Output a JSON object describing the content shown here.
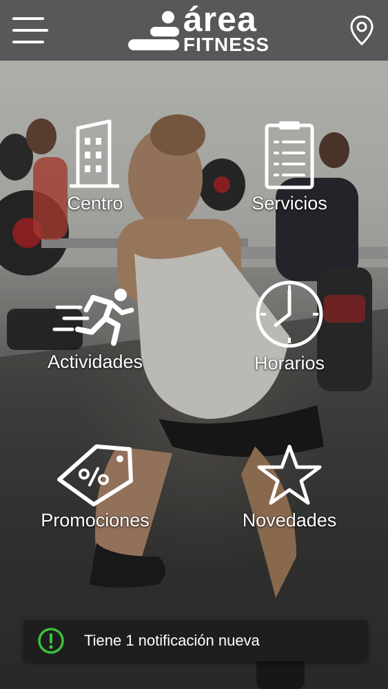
{
  "header": {
    "logo": {
      "word1": "área",
      "word2": "FITNESS"
    },
    "menu_icon": "hamburger-menu-icon",
    "location_icon": "map-pin-icon",
    "colors": {
      "bar": "#58585a",
      "foreground": "#ffffff"
    }
  },
  "menu": {
    "items": [
      {
        "label": "Centro",
        "icon": "building-icon"
      },
      {
        "label": "Servicios",
        "icon": "clipboard-list-icon"
      },
      {
        "label": "Actividades",
        "icon": "running-person-icon"
      },
      {
        "label": "Horarios",
        "icon": "clock-icon"
      },
      {
        "label": "Promociones",
        "icon": "discount-tag-icon"
      },
      {
        "label": "Novedades",
        "icon": "star-icon"
      }
    ]
  },
  "notification": {
    "text": "Tiene 1 notificación nueva",
    "icon": "alert-icon",
    "colors": {
      "accent": "#39c43a",
      "background": "#1e1e1e"
    }
  }
}
